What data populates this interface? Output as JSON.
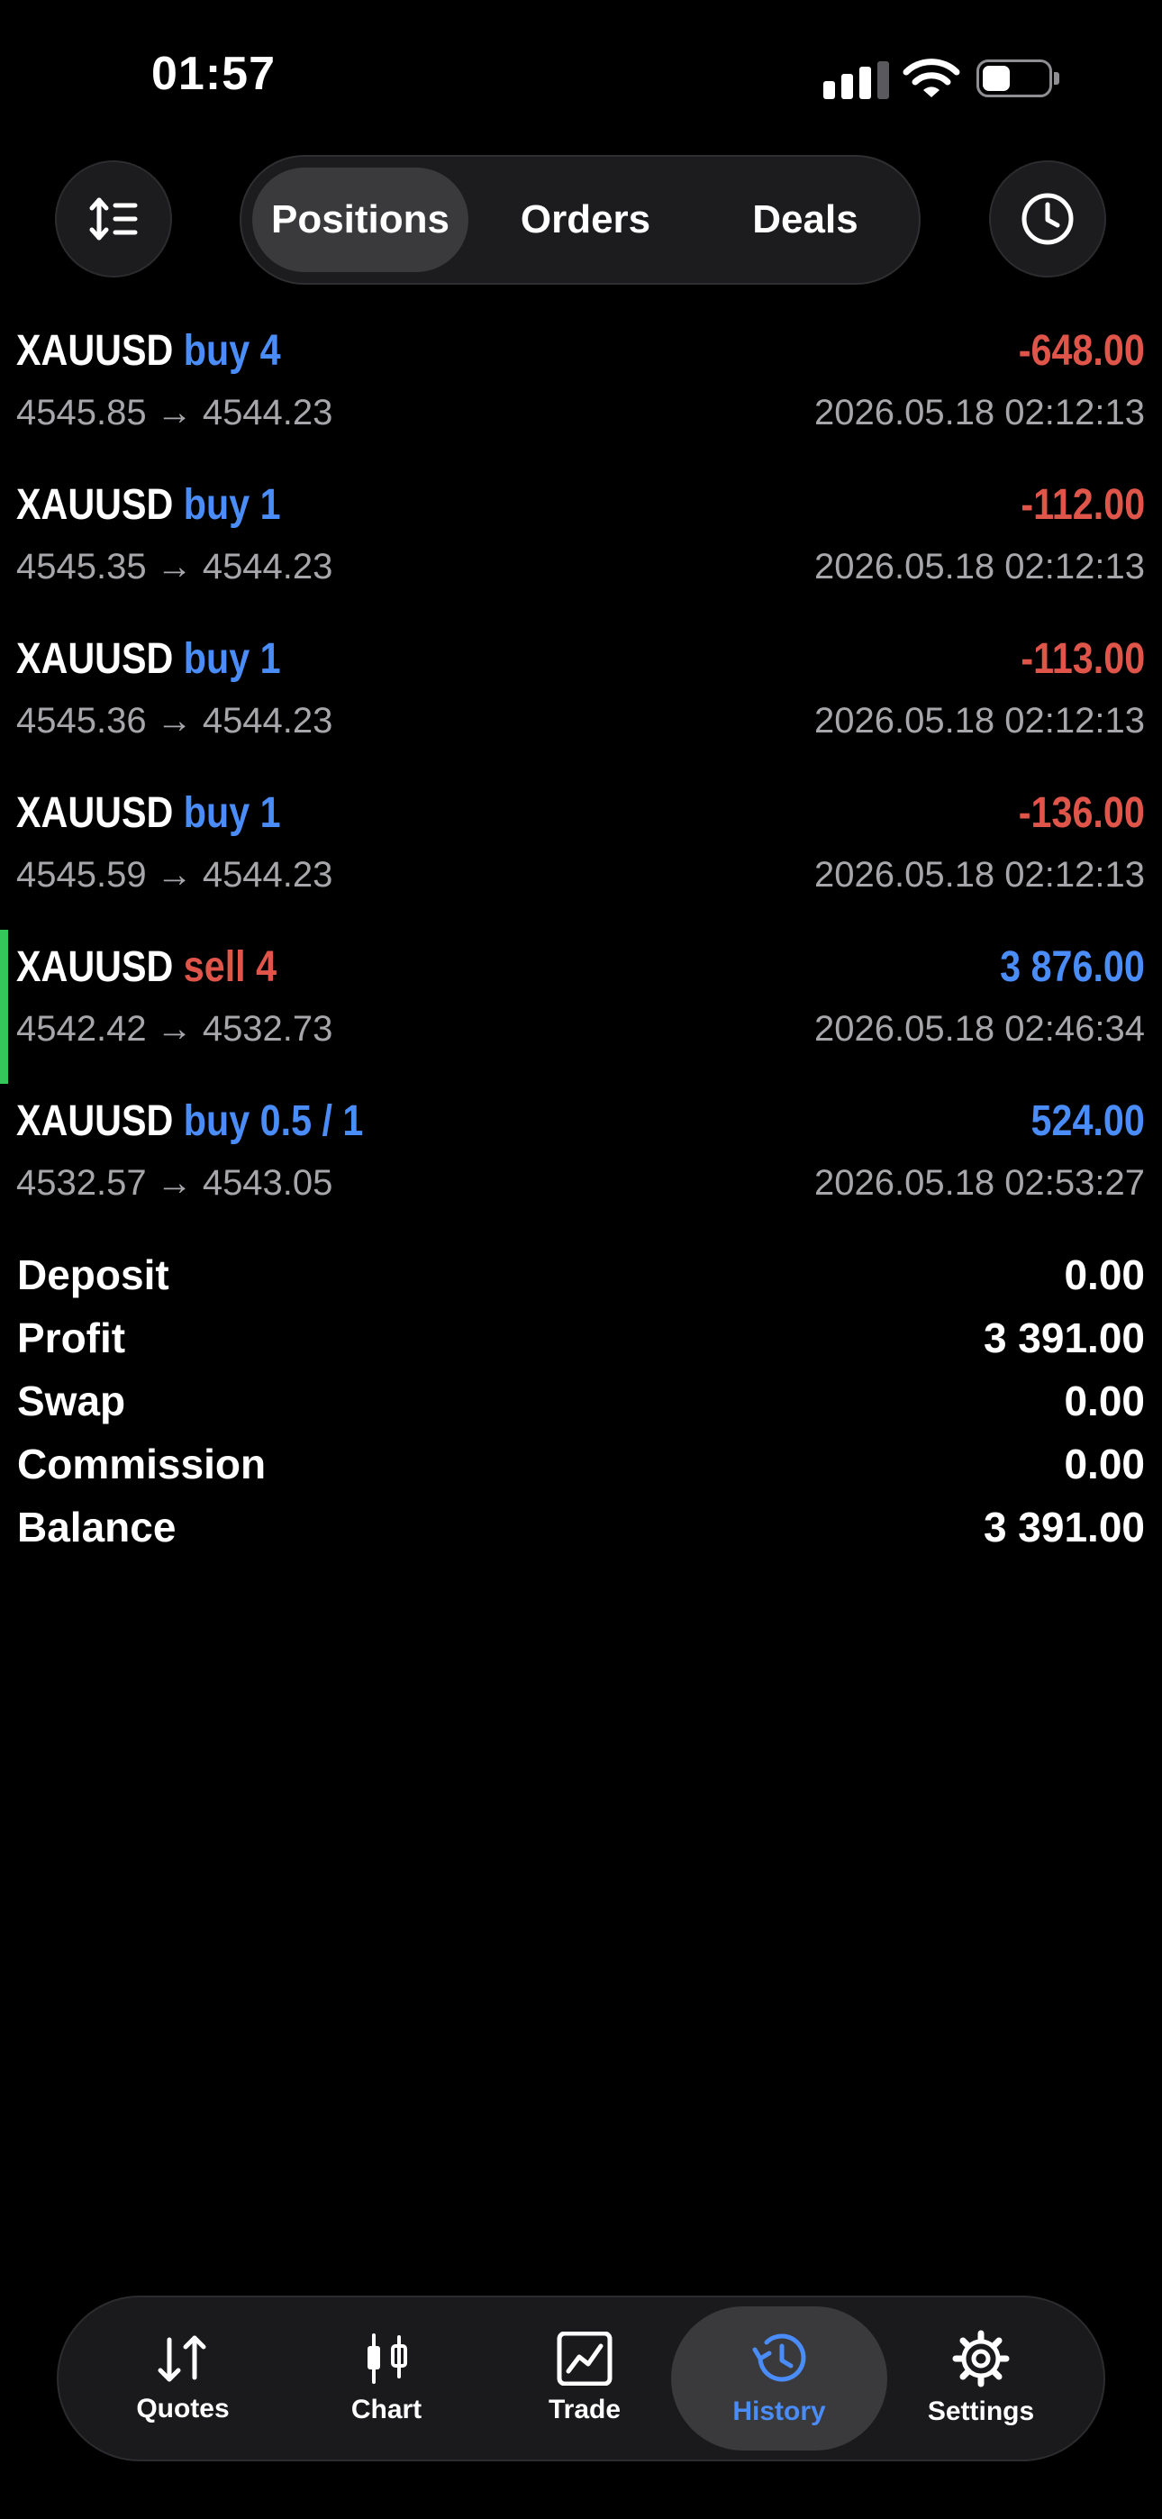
{
  "status": {
    "time": "01:57"
  },
  "tabs": {
    "positions": "Positions",
    "orders": "Orders",
    "deals": "Deals"
  },
  "positions": [
    {
      "symbol": "XAUUSD",
      "side": "buy 4",
      "profit": "-648.00",
      "prices": "4545.85 → 4544.23",
      "time": "2026.05.18 02:12:13"
    },
    {
      "symbol": "XAUUSD",
      "side": "buy 1",
      "profit": "-112.00",
      "prices": "4545.35 → 4544.23",
      "time": "2026.05.18 02:12:13"
    },
    {
      "symbol": "XAUUSD",
      "side": "buy 1",
      "profit": "-113.00",
      "prices": "4545.36 → 4544.23",
      "time": "2026.05.18 02:12:13"
    },
    {
      "symbol": "XAUUSD",
      "side": "buy 1",
      "profit": "-136.00",
      "prices": "4545.59 → 4544.23",
      "time": "2026.05.18 02:12:13"
    },
    {
      "symbol": "XAUUSD",
      "side": "sell 4",
      "profit": "3 876.00",
      "prices": "4542.42 → 4532.73",
      "time": "2026.05.18 02:46:34"
    },
    {
      "symbol": "XAUUSD",
      "side": "buy 0.5 / 1",
      "profit": "524.00",
      "prices": "4532.57 → 4543.05",
      "time": "2026.05.18 02:53:27"
    }
  ],
  "summary": {
    "deposit_label": "Deposit",
    "deposit": "0.00",
    "profit_label": "Profit",
    "profit": "3 391.00",
    "swap_label": "Swap",
    "swap": "0.00",
    "commission_label": "Commission",
    "commission": "0.00",
    "balance_label": "Balance",
    "balance": "3 391.00"
  },
  "nav": {
    "quotes": "Quotes",
    "chart": "Chart",
    "trade": "Trade",
    "history": "History",
    "settings": "Settings"
  },
  "colors": {
    "buy": "#4a8df8",
    "sell": "#e0554a",
    "loss": "#e0554a",
    "gain": "#4a8df8",
    "highlight_bar": "#34c759",
    "active_tab": "#4a8df8"
  }
}
